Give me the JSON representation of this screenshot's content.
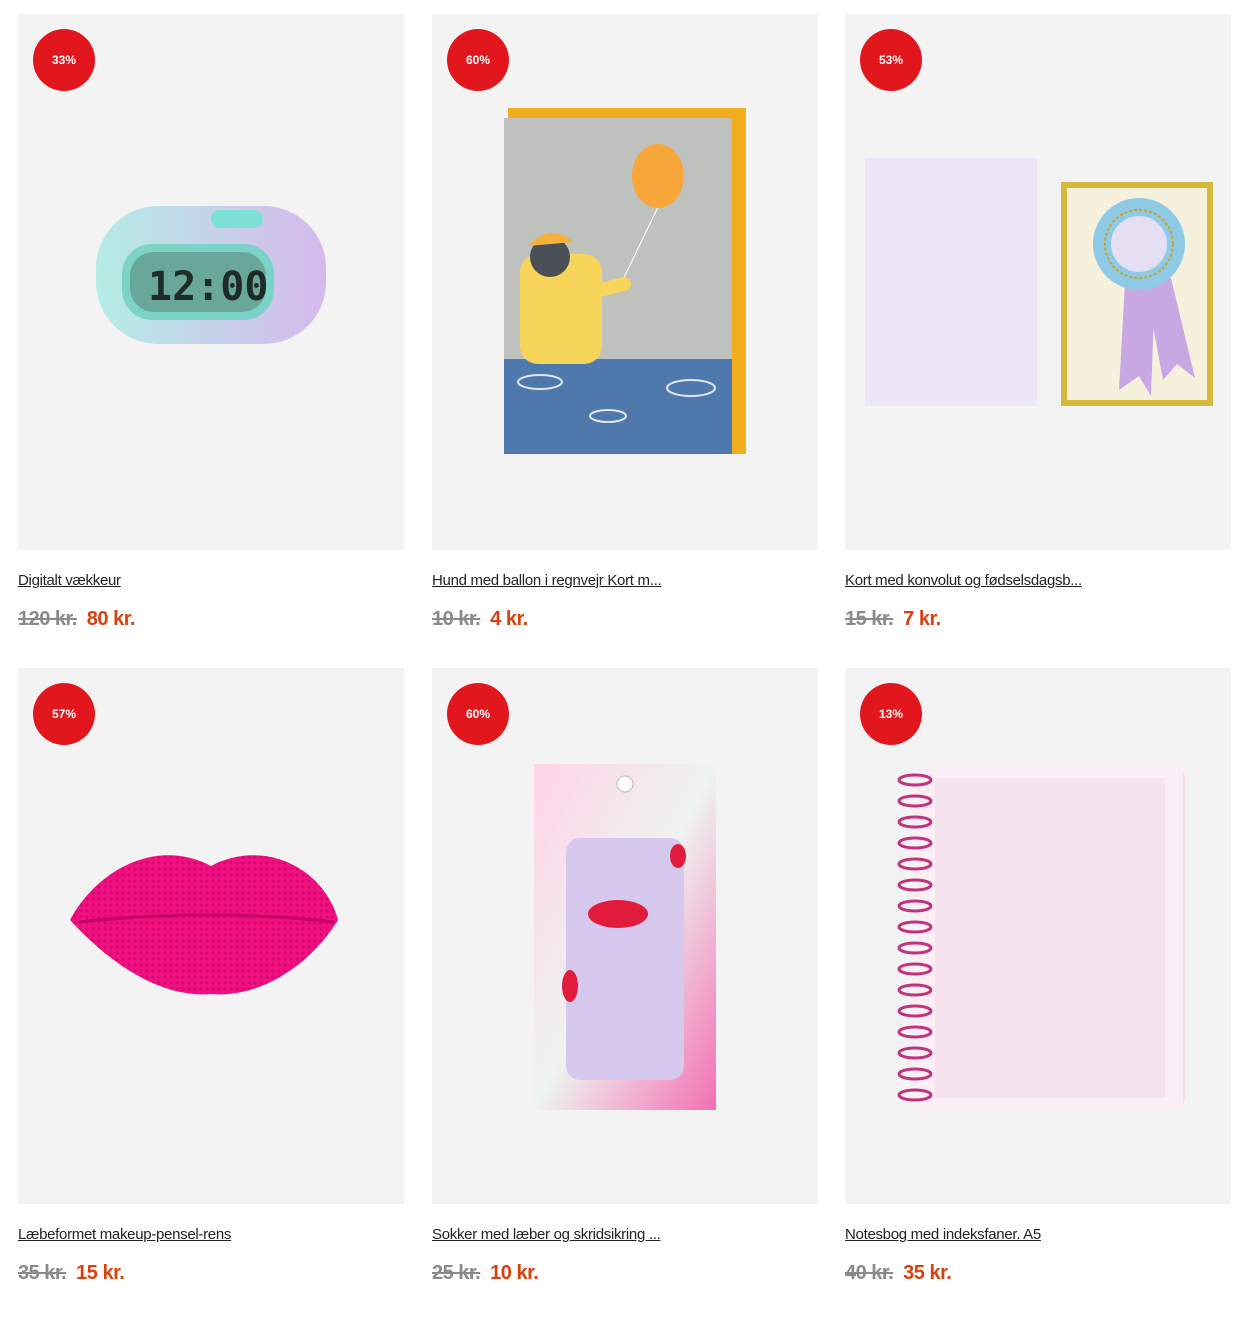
{
  "products": [
    {
      "discount": "33%",
      "title": "Digitalt vækkeur",
      "old_price": "120 kr.",
      "new_price": "80 kr.",
      "icon": "alarm-clock"
    },
    {
      "discount": "60%",
      "title": "Hund med ballon i regnvejr Kort m...",
      "old_price": "10 kr.",
      "new_price": "4 kr.",
      "icon": "greeting-card"
    },
    {
      "discount": "53%",
      "title": "Kort med konvolut og fødselsdagsb...",
      "old_price": "15 kr.",
      "new_price": "7 kr.",
      "icon": "birthday-card"
    },
    {
      "discount": "57%",
      "title": "Læbeformet makeup-pensel-rens",
      "old_price": "35 kr.",
      "new_price": "15 kr.",
      "icon": "lip-brush-cleaner"
    },
    {
      "discount": "60%",
      "title": "Sokker med læber og skridsikring ...",
      "old_price": "25 kr.",
      "new_price": "10 kr.",
      "icon": "socks-pack"
    },
    {
      "discount": "13%",
      "title": "Notesbog med indeksfaner. A5",
      "old_price": "40 kr.",
      "new_price": "35 kr.",
      "icon": "notebook"
    }
  ],
  "colors": {
    "badge": "#e2171e",
    "sale_price": "#d8410d",
    "old_price": "#8a8a8a",
    "card_bg": "#f3f3f3"
  }
}
